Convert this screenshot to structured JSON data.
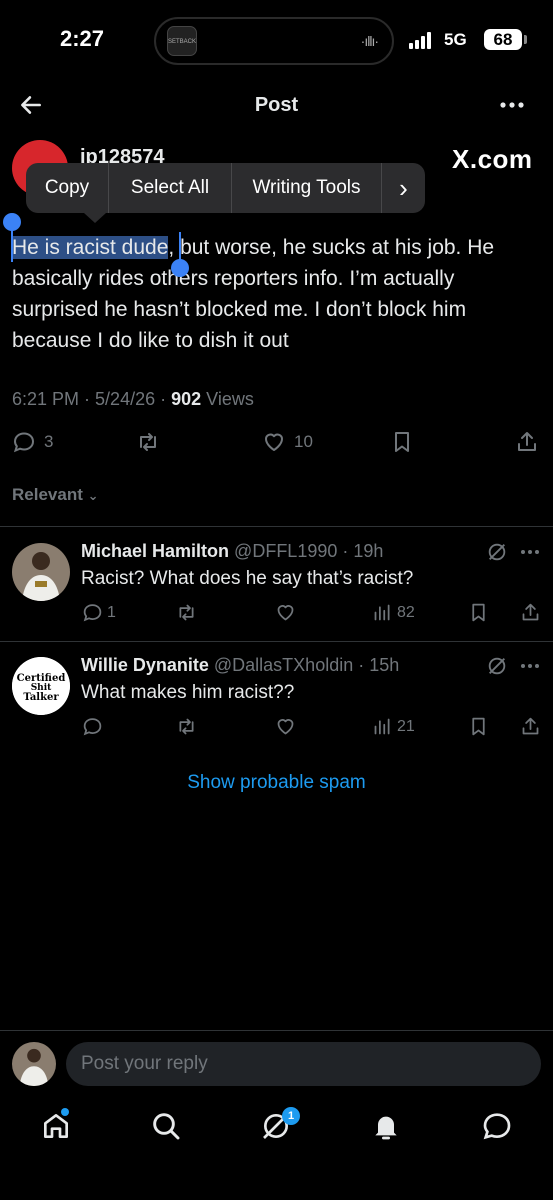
{
  "status_bar": {
    "time": "2:27",
    "island_thumb_label": "SETBACKS",
    "network": "5G",
    "battery": "68"
  },
  "header": {
    "title": "Post"
  },
  "post": {
    "author_handle": "jp128574",
    "source_brand": "X.com",
    "text_selected": "He is racist dude",
    "text_rest": ", but worse, he sucks at his job. He basically rides others reporters info. I’m actually surprised he hasn’t blocked me.  I don’t block him because I do like to dish it out",
    "time": "6:21 PM",
    "date": "5/24/26",
    "views_count": "902",
    "views_label": "Views",
    "replies": "3",
    "likes": "10"
  },
  "context_menu": {
    "copy": "Copy",
    "select_all": "Select All",
    "writing_tools": "Writing Tools",
    "more": "›"
  },
  "replies_filter": {
    "label": "Relevant"
  },
  "replies": [
    {
      "name": "Michael Hamilton",
      "handle": "@DFFL1990",
      "age": "19h",
      "text": "Racist? What does he say that’s racist?",
      "reply_count": "1",
      "views": "82"
    },
    {
      "name": "Willie Dynanite",
      "handle": "@DallasTXholdin",
      "age": "15h",
      "text": "What makes him racist??",
      "views": "21",
      "avatar_text": [
        "Certified",
        "Shit",
        "Talker"
      ]
    }
  ],
  "spam_link": "Show probable spam",
  "composer": {
    "placeholder": "Post your reply"
  },
  "bottom_nav": {
    "messages_badge": "1"
  },
  "colors": {
    "background": "#000000",
    "accent": "#1d9bf0",
    "selection": "#2d4f86",
    "muted_text": "#71767b",
    "author_avatar": "#d7262c"
  }
}
